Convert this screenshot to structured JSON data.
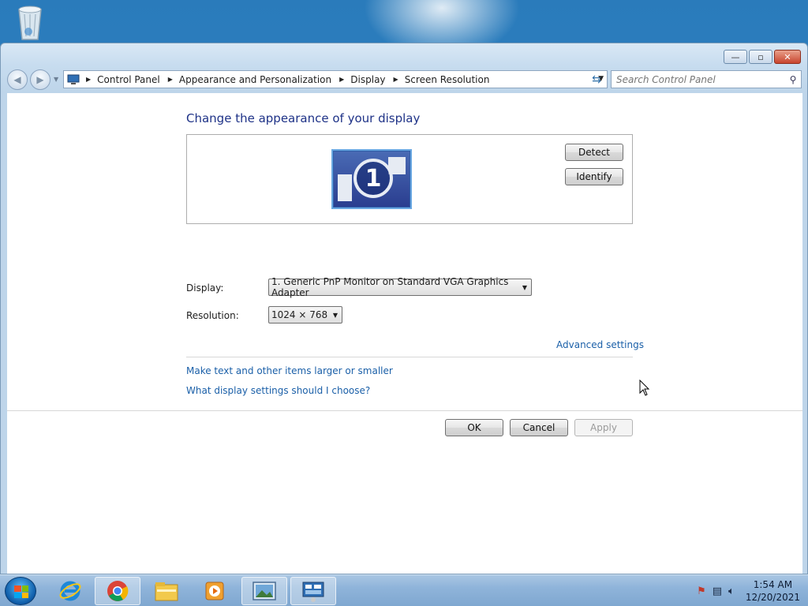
{
  "window": {
    "controls": {
      "minimize": "—",
      "maximize": "▫",
      "close": "✕"
    }
  },
  "navigation": {
    "breadcrumbs": [
      "Control Panel",
      "Appearance and Personalization",
      "Display",
      "Screen Resolution"
    ],
    "search_placeholder": "Search Control Panel"
  },
  "main": {
    "heading": "Change the appearance of your display",
    "monitor_number": "1",
    "detect_label": "Detect",
    "identify_label": "Identify",
    "display_label": "Display:",
    "display_value": "1. Generic PnP Monitor on Standard VGA Graphics Adapter",
    "resolution_label": "Resolution:",
    "resolution_value": "1024 × 768",
    "advanced_link": "Advanced settings",
    "link_text_size": "Make text and other items larger or smaller",
    "link_help": "What display settings should I choose?",
    "ok_label": "OK",
    "cancel_label": "Cancel",
    "apply_label": "Apply"
  },
  "taskbar": {
    "apps": [
      "internet-explorer",
      "chrome",
      "file-explorer",
      "media-player",
      "photo-viewer",
      "control-panel"
    ],
    "time": "1:54 AM",
    "date": "12/20/2021"
  }
}
